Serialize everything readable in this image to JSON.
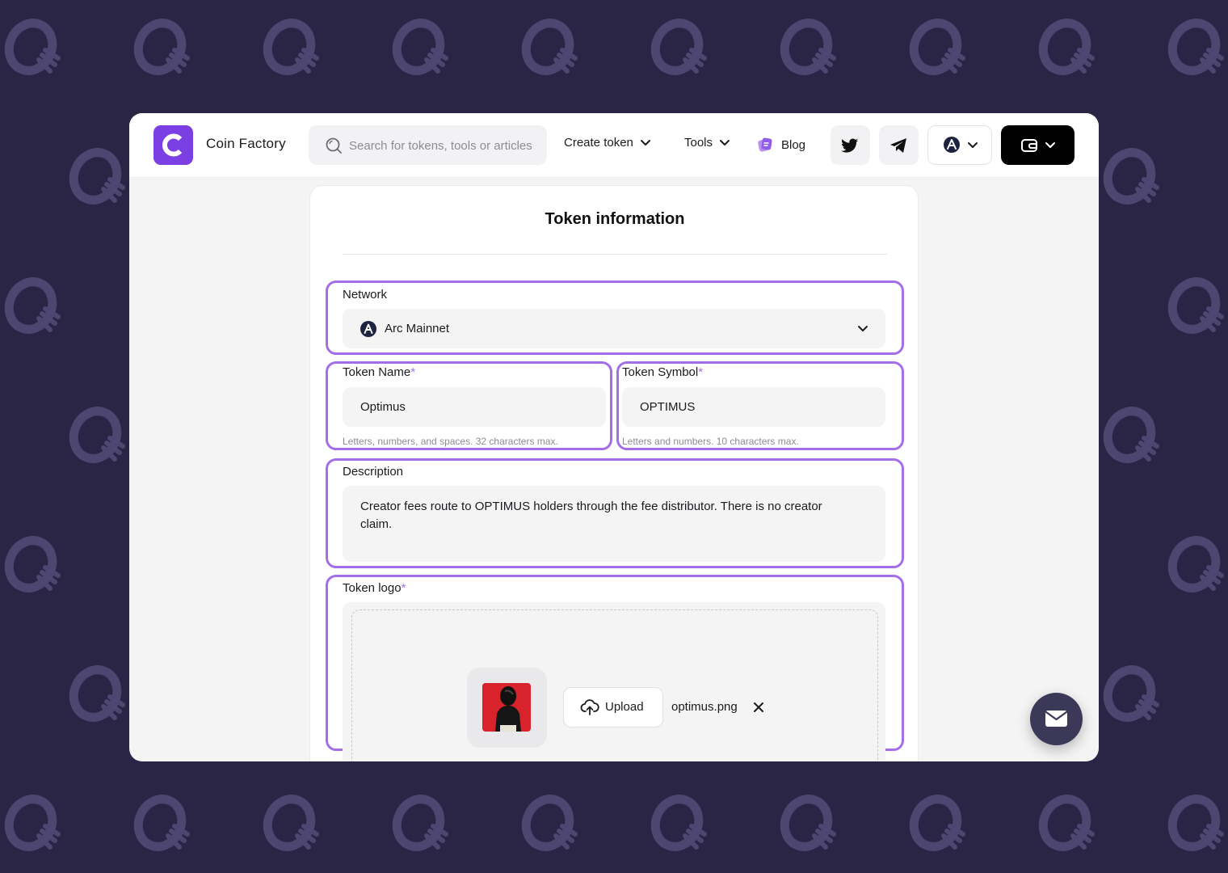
{
  "colors": {
    "background": "#2b2545",
    "accent": "#7b3fe4",
    "highlight": "#a46ee8",
    "field": "#f4f4f5"
  },
  "navbar": {
    "brand": "Coin Factory",
    "search_placeholder": "Search for tokens, tools or articles",
    "create_token": "Create token",
    "tools": "Tools",
    "blog": "Blog",
    "icons": [
      "twitter-icon",
      "telegram-icon",
      "network-icon",
      "wallet-icon"
    ]
  },
  "form": {
    "title": "Token information",
    "network": {
      "label": "Network",
      "value": "Arc Mainnet"
    },
    "token_name": {
      "label": "Token Name",
      "required_mark": "*",
      "value": "Optimus",
      "hint": "Letters, numbers, and spaces. 32 characters max."
    },
    "token_symbol": {
      "label": "Token Symbol",
      "required_mark": "*",
      "value": "OPTIMUS",
      "hint": "Letters and numbers. 10 characters max."
    },
    "description": {
      "label": "Description",
      "value": "Creator fees route to OPTIMUS holders through the fee distributor. There is no creator claim."
    },
    "token_logo": {
      "label": "Token logo",
      "required_mark": "*",
      "upload_label": "Upload",
      "filename": "optimus.png"
    }
  }
}
